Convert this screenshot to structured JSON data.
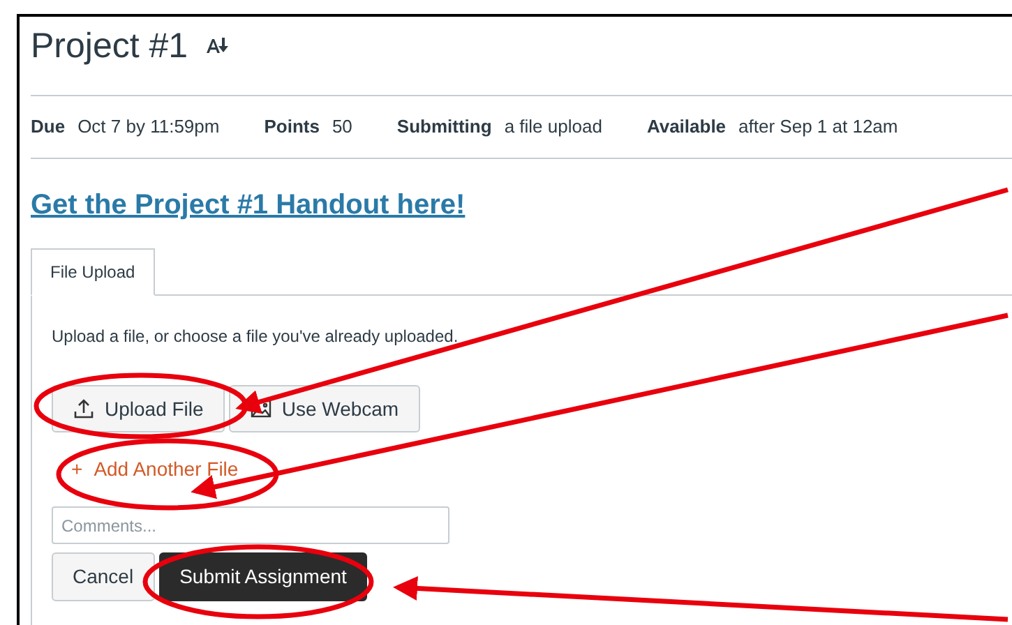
{
  "title": "Project #1",
  "details": [
    {
      "label": "Due",
      "value": "Oct 7 by 11:59pm"
    },
    {
      "label": "Points",
      "value": "50"
    },
    {
      "label": "Submitting",
      "value": "a file upload"
    },
    {
      "label": "Available",
      "value": "after Sep 1 at 12am"
    }
  ],
  "handout_link": "Get the Project #1 Handout here!",
  "tabs": [
    {
      "label": "File Upload",
      "selected": true
    }
  ],
  "instructions": "Upload a file, or choose a file you've already uploaded.",
  "upload_buttons": [
    {
      "label": "Upload File",
      "kind": "upload"
    },
    {
      "label": "Use Webcam",
      "kind": "webcam"
    }
  ],
  "add_file": {
    "icon": "+",
    "label": "Add Another File"
  },
  "comments": {
    "placeholder": "Comments..."
  },
  "actions": [
    {
      "label": "Cancel",
      "kind": "secondary"
    },
    {
      "label": "Submit Assignment",
      "kind": "primary"
    }
  ]
}
